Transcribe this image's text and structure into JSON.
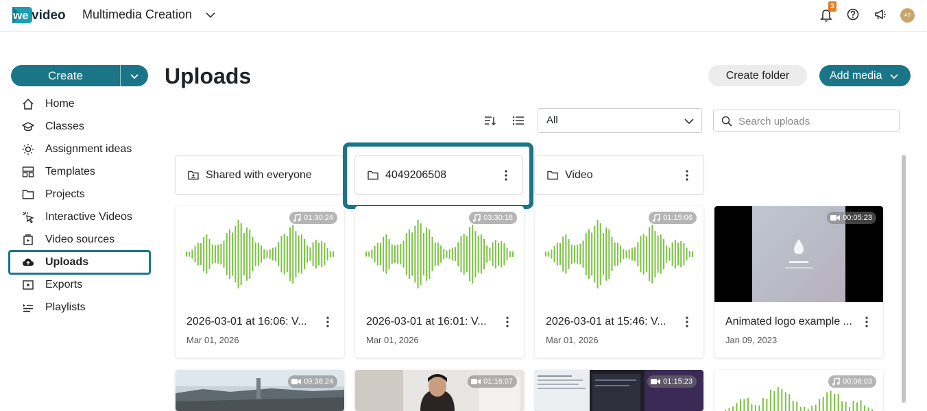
{
  "header": {
    "brand": "wevideo",
    "workspace_title": "Multimedia Creation",
    "notification_count": "3",
    "avatar_initials": "AS"
  },
  "sidebar": {
    "create_label": "Create",
    "items": [
      {
        "label": "Home",
        "icon": "home-icon"
      },
      {
        "label": "Classes",
        "icon": "classes-icon"
      },
      {
        "label": "Assignment ideas",
        "icon": "lightbulb-icon"
      },
      {
        "label": "Templates",
        "icon": "templates-icon"
      },
      {
        "label": "Projects",
        "icon": "folder-icon"
      },
      {
        "label": "Interactive Videos",
        "icon": "cursor-click-icon"
      },
      {
        "label": "Video sources",
        "icon": "video-sources-icon"
      },
      {
        "label": "Uploads",
        "icon": "cloud-upload-icon",
        "active": true
      },
      {
        "label": "Exports",
        "icon": "export-icon"
      },
      {
        "label": "Playlists",
        "icon": "playlist-icon"
      }
    ]
  },
  "main": {
    "title": "Uploads",
    "create_folder_label": "Create folder",
    "add_media_label": "Add media",
    "filter_value": "All",
    "search_placeholder": "Search uploads",
    "folders": [
      {
        "name": "Shared with everyone",
        "shared": true
      },
      {
        "name": "4049206508"
      },
      {
        "name": "Video"
      }
    ],
    "media": [
      {
        "title": "2026-03-01 at 16:06: V...",
        "date": "Mar 01, 2026",
        "duration": "01:30:24",
        "kind": "audio"
      },
      {
        "title": "2026-03-01 at 16:01: V...",
        "date": "Mar 01, 2026",
        "duration": "03:30:18",
        "kind": "audio"
      },
      {
        "title": "2026-03-01 at 15:46: V...",
        "date": "Mar 01, 2026",
        "duration": "01:15:06",
        "kind": "audio"
      },
      {
        "title": "Animated logo example ...",
        "date": "Jan 09, 2023",
        "duration": "00:05:23",
        "kind": "video"
      }
    ],
    "media_row2": [
      {
        "duration": "09:38:24",
        "kind": "video"
      },
      {
        "duration": "01:16:07",
        "kind": "video"
      },
      {
        "duration": "01:15:23",
        "kind": "video"
      },
      {
        "duration": "00:06:03",
        "kind": "audio"
      }
    ]
  },
  "colors": {
    "accent": "#1a7589",
    "waveform": "#7cc242",
    "badge": "#d9822b"
  }
}
